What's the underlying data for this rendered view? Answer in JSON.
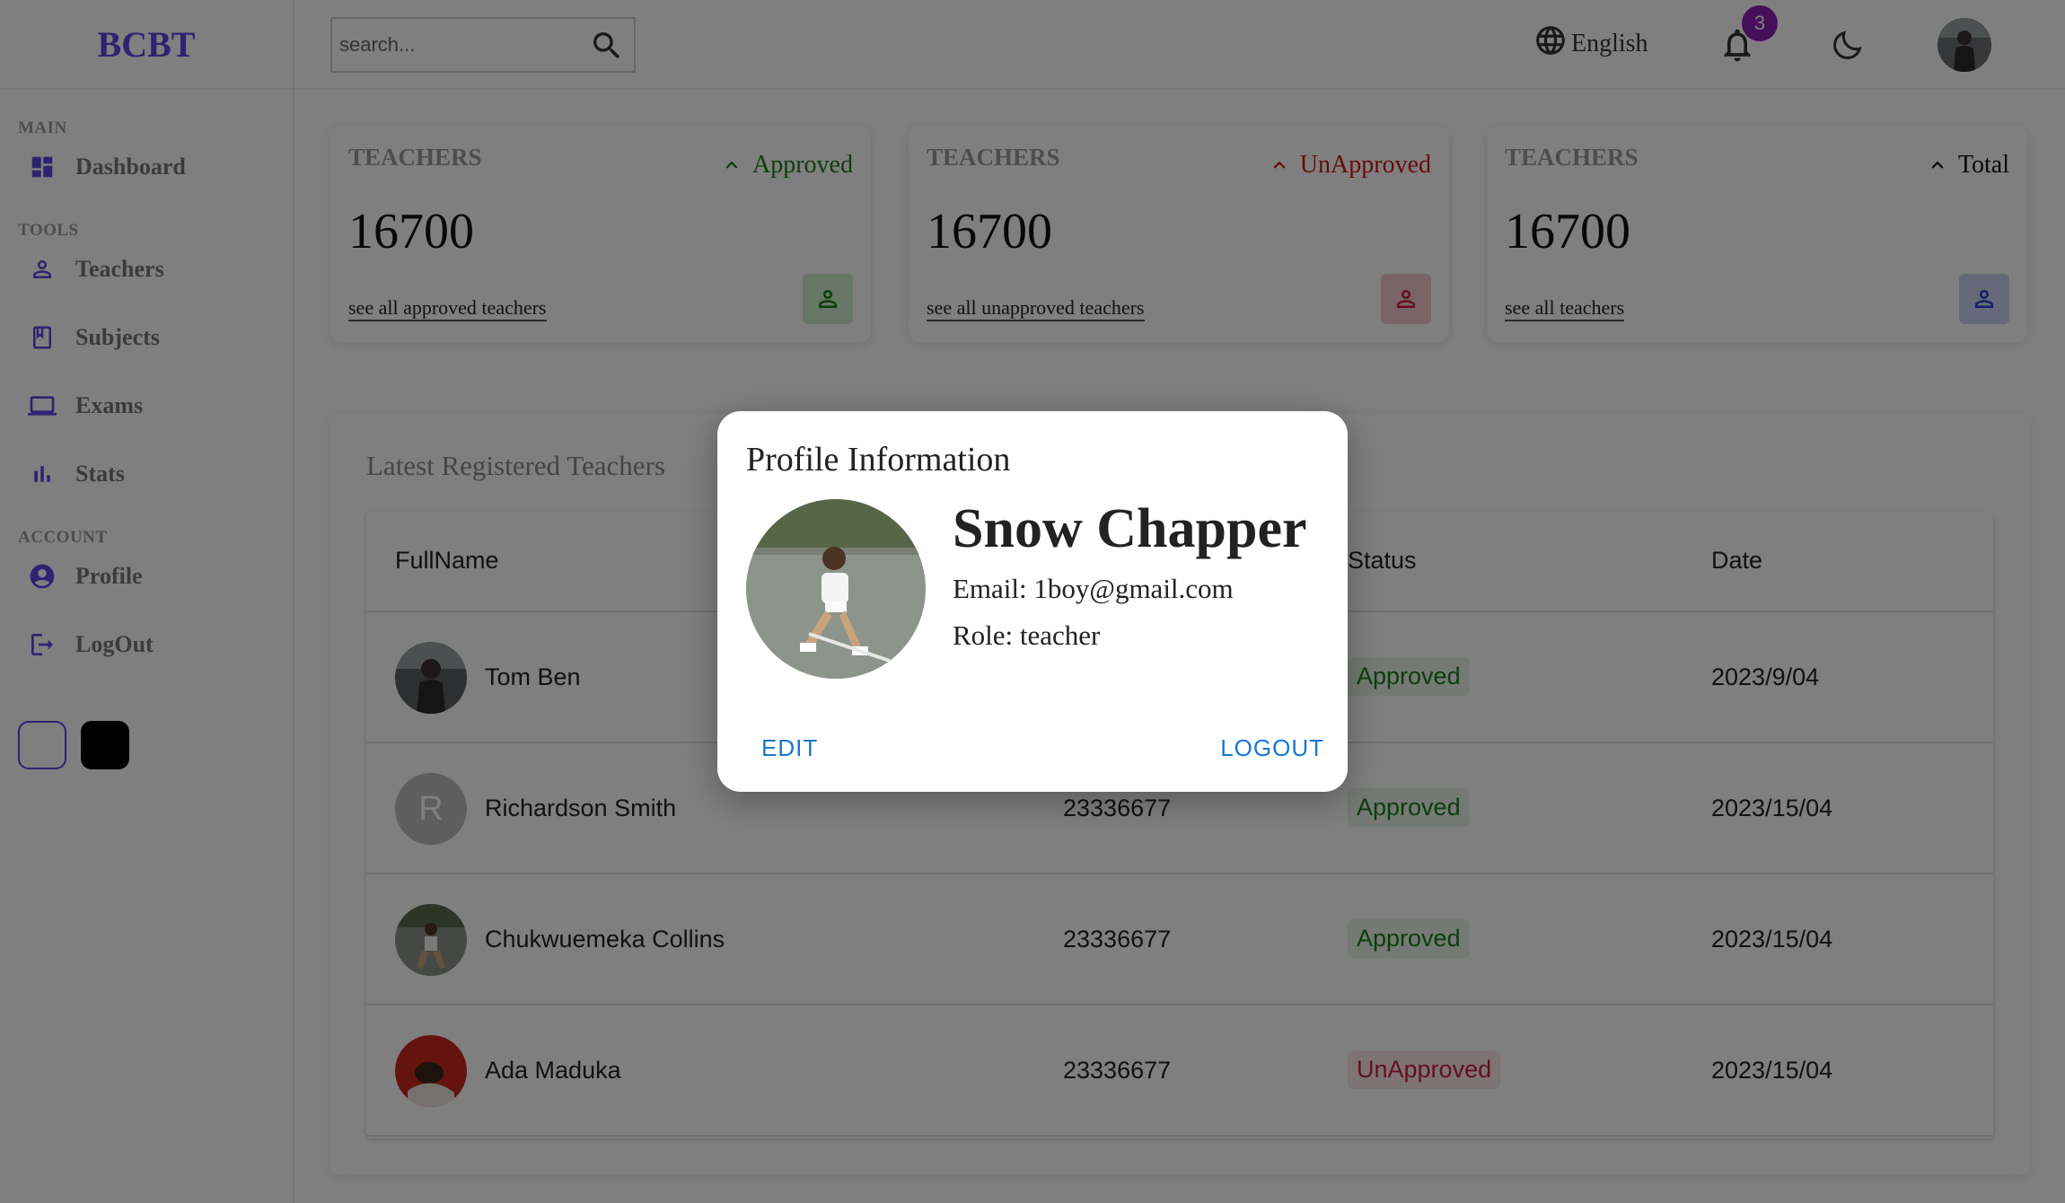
{
  "brand": {
    "name": "BCBT"
  },
  "sidebar": {
    "sections": [
      {
        "title": "MAIN"
      },
      {
        "title": "TOOLS"
      },
      {
        "title": "ACCOUNT"
      }
    ],
    "items": [
      {
        "label": "Dashboard",
        "icon": "dashboard-icon"
      },
      {
        "label": "Teachers",
        "icon": "person-icon"
      },
      {
        "label": "Subjects",
        "icon": "book-icon"
      },
      {
        "label": "Exams",
        "icon": "laptop-icon"
      },
      {
        "label": "Stats",
        "icon": "bar-chart-icon"
      },
      {
        "label": "Profile",
        "icon": "account-circle-icon"
      },
      {
        "label": "LogOut",
        "icon": "logout-icon"
      }
    ],
    "theme_swatches": [
      {
        "name": "light",
        "color": "#ffffff"
      },
      {
        "name": "dark",
        "color": "#000000"
      }
    ]
  },
  "topbar": {
    "search_placeholder": "search...",
    "language": "English",
    "notification_count": "3"
  },
  "cards": [
    {
      "title": "TEACHERS",
      "status": "Approved",
      "status_color": "#1b7a1b",
      "value": "16700",
      "link": "see all approved teachers",
      "icon_bg": "#cfeccc",
      "icon_color": "#1b7a1b"
    },
    {
      "title": "TEACHERS",
      "status": "UnApproved",
      "status_color": "#d01616",
      "value": "16700",
      "link": "see all unapproved teachers",
      "icon_bg": "#f6c9cf",
      "icon_color": "#c81e3c"
    },
    {
      "title": "TEACHERS",
      "status": "Total",
      "status_color": "#111111",
      "value": "16700",
      "link": "see all teachers",
      "icon_bg": "#cdd3f3",
      "icon_color": "#2a3ec8"
    }
  ],
  "table": {
    "title": "Latest Registered Teachers",
    "columns": [
      "FullName",
      "Status",
      "Date"
    ],
    "rows": [
      {
        "name": "Tom Ben",
        "id": "",
        "status": "Approved",
        "date": "2023/9/04",
        "avatar": "photo"
      },
      {
        "name": "Richardson Smith",
        "id": "23336677",
        "status": "Approved",
        "date": "2023/15/04",
        "avatar": "letter",
        "initial": "R"
      },
      {
        "name": "Chukwuemeka Collins",
        "id": "23336677",
        "status": "Approved",
        "date": "2023/15/04",
        "avatar": "photo"
      },
      {
        "name": "Ada Maduka",
        "id": "23336677",
        "status": "UnApproved",
        "date": "2023/15/04",
        "avatar": "photo"
      }
    ],
    "status_colors": {
      "Approved": "#1b7a1b",
      "UnApproved": "#c81e3c"
    },
    "status_bgs": {
      "Approved": "#e8f5e6",
      "UnApproved": "#fbe6e9"
    }
  },
  "modal": {
    "title": "Profile Information",
    "name": "Snow Chapper",
    "email": "Email: 1boy@gmail.com",
    "role": "Role: teacher",
    "edit_label": "EDIT",
    "logout_label": "LOGOUT"
  }
}
